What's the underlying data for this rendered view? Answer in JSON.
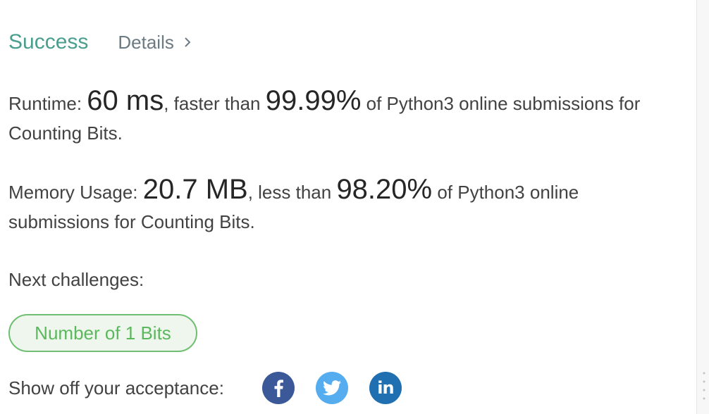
{
  "header": {
    "status": "Success",
    "details_label": "Details"
  },
  "runtime": {
    "label": "Runtime: ",
    "value": "60 ms",
    "comparison": ", faster than ",
    "percent": "99.99%",
    "suffix": " of Python3 online submissions for",
    "line2": "Counting Bits."
  },
  "memory": {
    "label": "Memory Usage: ",
    "value": "20.7 MB",
    "comparison": ", less than ",
    "percent": "98.20%",
    "suffix": " of Python3 online",
    "line2": "submissions for Counting Bits."
  },
  "next": {
    "label": "Next challenges:",
    "items": [
      {
        "title": "Number of 1 Bits"
      }
    ]
  },
  "share": {
    "label": "Show off your acceptance:",
    "networks": [
      "facebook-icon",
      "twitter-icon",
      "linkedin-icon"
    ],
    "linkedin_text": "in"
  },
  "colors": {
    "success": "#4a9e8e",
    "challenge_border": "#6fbf73",
    "challenge_text": "#5cb85c",
    "facebook": "#3b5998",
    "twitter": "#55acee",
    "linkedin": "#1f6fb1"
  }
}
